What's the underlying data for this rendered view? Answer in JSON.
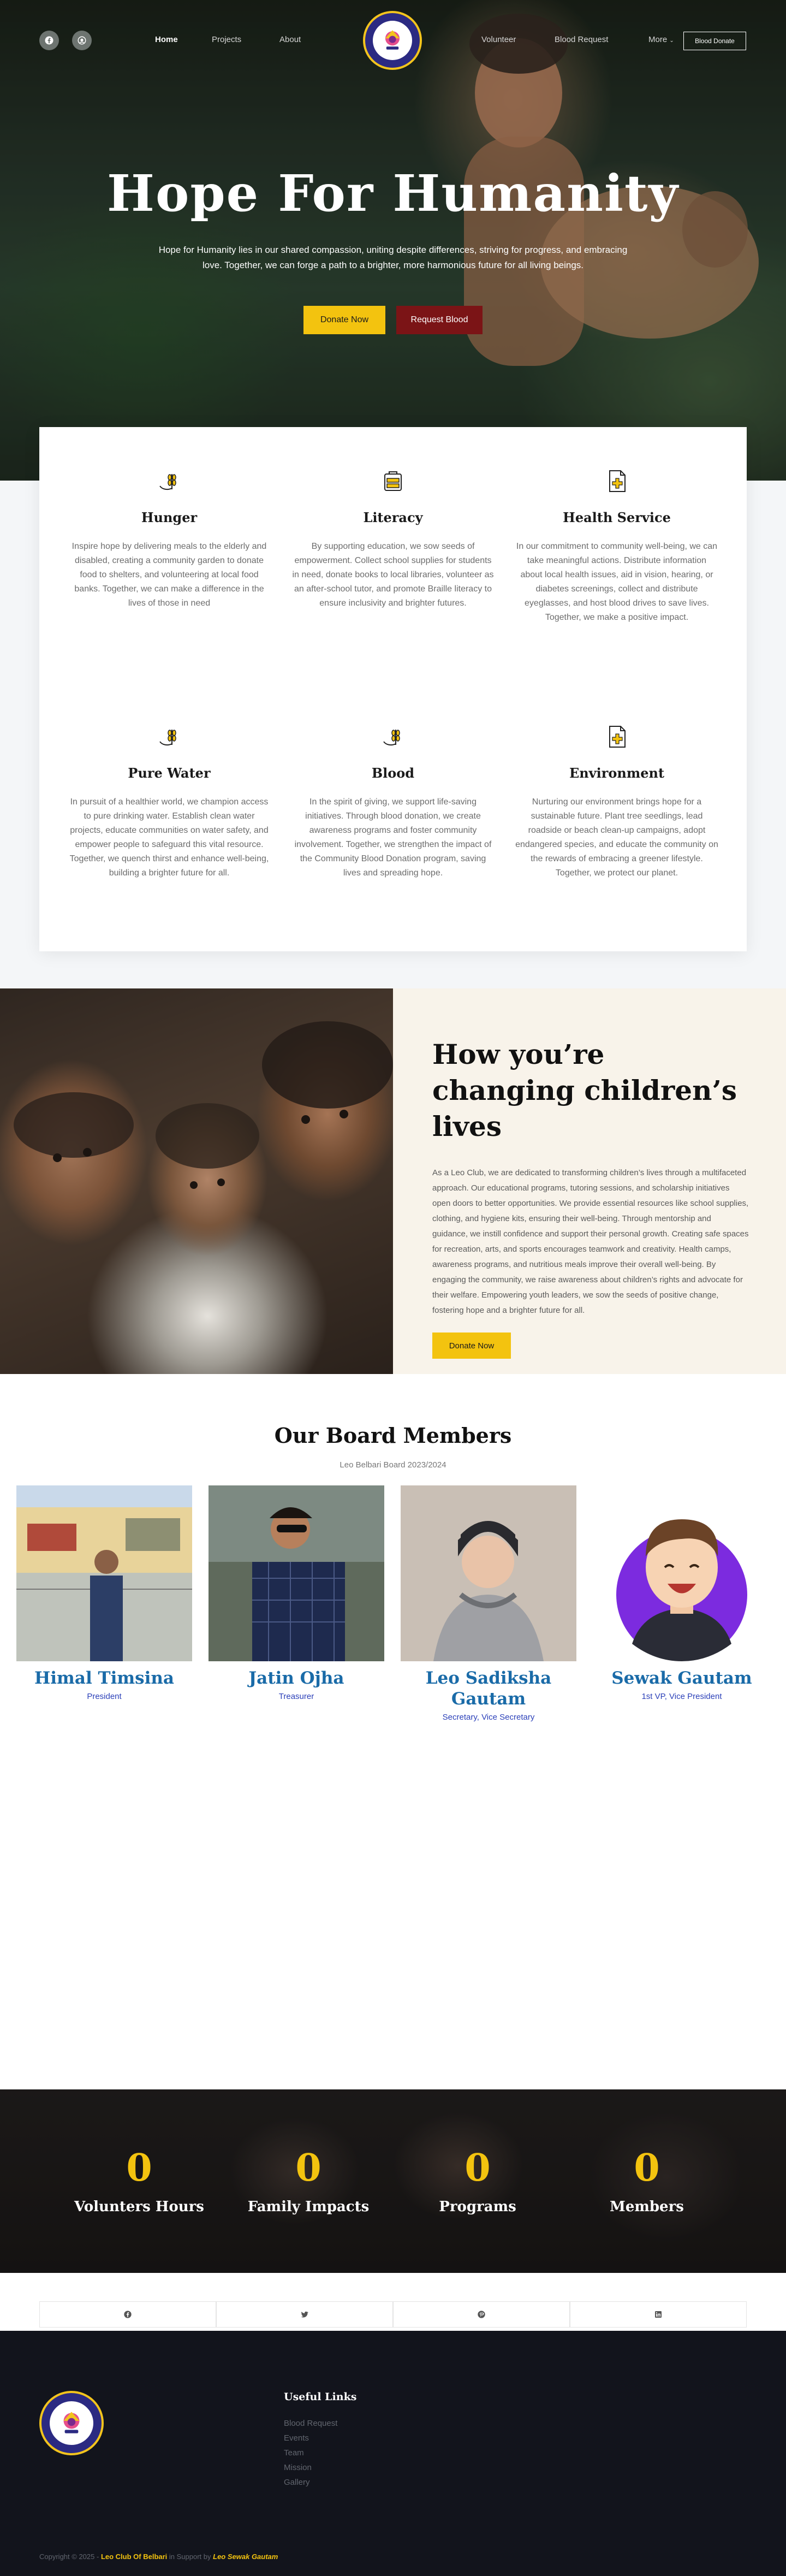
{
  "nav": {
    "links": [
      "Home",
      "Projects",
      "About",
      "Volunteer",
      "Blood Request"
    ],
    "more": "More",
    "cta": "Blood Donate"
  },
  "hero": {
    "title": "Hope For Humanity",
    "subtitle": "Hope for Humanity lies in our shared compassion, uniting despite differences, striving for progress, and embracing love. Together, we can forge a path to a brighter, more harmonious future for all living beings.",
    "donate_label": "Donate Now",
    "request_label": "Request Blood"
  },
  "services": [
    {
      "title": "Hunger",
      "icon": "wheat-icon",
      "text": "Inspire hope by delivering meals to the elderly and disabled, creating a community garden to donate food to shelters, and volunteering at local food banks. Together, we can make a difference in the lives of those in need"
    },
    {
      "title": "Literacy",
      "icon": "book-stack-icon",
      "text": "By supporting education, we sow seeds of empowerment. Collect school supplies for students in need, donate books to local libraries, volunteer as an after-school tutor, and promote Braille literacy to ensure inclusivity and brighter futures."
    },
    {
      "title": "Health Service",
      "icon": "medical-document-icon",
      "text": "In our commitment to community well-being, we can take meaningful actions. Distribute information about local health issues, aid in vision, hearing, or diabetes screenings, collect and distribute eyeglasses, and host blood drives to save lives. Together, we make a positive impact."
    },
    {
      "title": "Pure Water",
      "icon": "wheat-icon",
      "text": "In pursuit of a healthier world, we champion access to pure drinking water. Establish clean water projects, educate communities on water safety, and empower people to safeguard this vital resource. Together, we quench thirst and enhance well-being, building a brighter future for all."
    },
    {
      "title": "Blood",
      "icon": "wheat-icon",
      "text": "In the spirit of giving, we support life-saving initiatives. Through blood donation, we create awareness programs and foster community involvement. Together, we strengthen the impact of the Community Blood Donation program, saving lives and spreading hope."
    },
    {
      "title": "Environment",
      "icon": "medical-document-icon",
      "text": "Nurturing our environment brings hope for a sustainable future. Plant tree seedlings, lead roadside or beach clean-up campaigns, adopt endangered species, and educate the community on the rewards of embracing a greener lifestyle. Together, we protect our planet."
    }
  ],
  "changing": {
    "title": "How you’re changing children’s lives",
    "body": "As a Leo Club, we are dedicated to transforming children’s lives through a multifaceted approach. Our educational programs, tutoring sessions, and scholarship initiatives open doors to better opportunities. We provide essential resources like school supplies, clothing, and hygiene kits, ensuring their well-being. Through mentorship and guidance, we instill confidence and support their personal growth. Creating safe spaces for recreation, arts, and sports encourages teamwork and creativity. Health camps, awareness programs, and nutritious meals improve their overall well-being. By engaging the community, we raise awareness about children’s rights and advocate for their welfare. Empowering youth leaders, we sow the seeds of positive change, fostering hope and a brighter future for all.",
    "button": "Donate Now"
  },
  "board": {
    "title": "Our Board Members",
    "subtitle": "Leo Belbari Board 2023/2024",
    "members": [
      {
        "name": "Himal Timsina",
        "role": "President"
      },
      {
        "name": "Jatin Ojha",
        "role": "Treasurer"
      },
      {
        "name": "Leo Sadiksha Gautam",
        "role": "Secretary, Vice Secretary"
      },
      {
        "name": "Sewak Gautam",
        "role": "1st VP, Vice President"
      }
    ]
  },
  "stats": [
    {
      "value": "0",
      "label": "Volunters Hours"
    },
    {
      "value": "0",
      "label": "Family Impacts"
    },
    {
      "value": "0",
      "label": "Programs"
    },
    {
      "value": "0",
      "label": "Members"
    }
  ],
  "share": [
    "facebook-icon",
    "twitter-icon",
    "pinterest-icon",
    "linkedin-icon"
  ],
  "footer": {
    "useful_title": "Useful Links",
    "links": [
      "Blood Request",
      "Events",
      "Team",
      "Mission",
      "Gallery"
    ],
    "copyright_prefix": "Copyright © 2025 -",
    "club": "Leo Club Of Belbari",
    "support": "in Support by",
    "author": "Leo Sewak Gautam"
  },
  "colors": {
    "accent": "#f3c30f",
    "red": "#7b1416",
    "link_blue": "#1a6ba8",
    "footer_bg": "#12141c"
  }
}
